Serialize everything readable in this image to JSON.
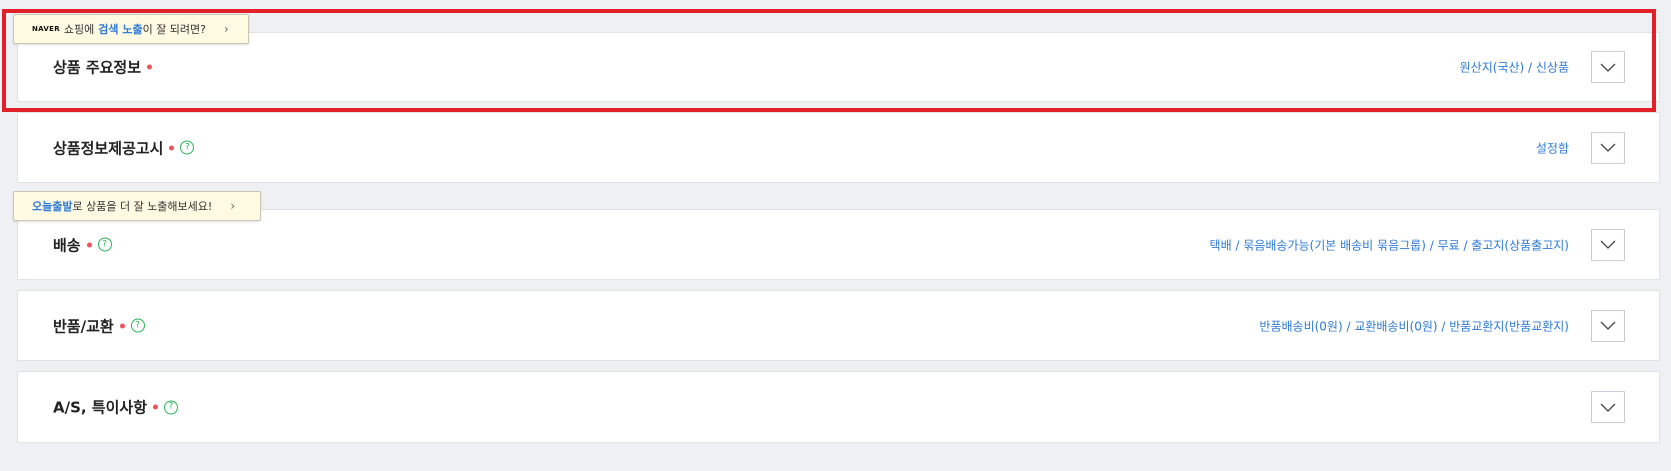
{
  "sections": [
    {
      "title": "상품 주요정보",
      "summary": "원산지(국산) / 신상품"
    },
    {
      "title": "상품정보제공고시",
      "summary": "설정함",
      "help": "?"
    },
    {
      "title": "배송",
      "summary": "택배 / 묶음배송가능(기본 배송비 묶음그룹) / 무료 / 출고지(상품출고지)",
      "help": "?"
    },
    {
      "title": "반품/교환",
      "summary": "반품배송비(0원) / 교환배송비(0원) / 반품교환지(반품교환지)",
      "help": "?"
    },
    {
      "title": "A/S, 특이사항",
      "summary": "",
      "help": "?"
    }
  ],
  "tooltips": {
    "naver": {
      "logo": "NAVER",
      "text_1": "쇼핑에",
      "highlight": "검색 노출",
      "text_2": "이 잘 되려면?",
      "arrow": "›"
    },
    "today": {
      "highlight": "오늘출발",
      "text": "로 상품을 더 잘 노출해보세요!",
      "arrow": "›"
    }
  },
  "colors": {
    "accent": "#2f7bd7",
    "required_dot": "#f0505a",
    "help_icon": "#2eb45a",
    "highlight_border": "#e1202a"
  },
  "icons": {
    "toggle": "chevron-down-icon",
    "help": "question-circle-icon",
    "tooltip_arrow": "chevron-right-icon"
  }
}
